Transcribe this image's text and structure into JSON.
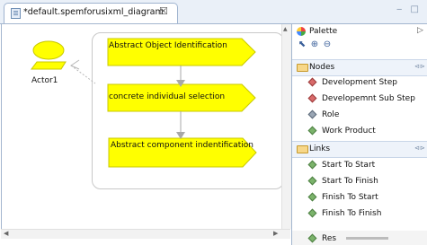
{
  "editor_tab": {
    "title": "*default.spemforusixml_diagram",
    "close_glyph": "☒"
  },
  "window_controls": "‒ □",
  "diagram": {
    "actor_label": "Actor1",
    "tasks": [
      {
        "label": "Abstract Object Identification"
      },
      {
        "label": "concrete individual selection"
      },
      {
        "label": "Abstract component indentification"
      }
    ],
    "colors": {
      "task_fill": "#ffff00",
      "task_stroke": "#c8c800",
      "arrow": "#a8a8a8"
    }
  },
  "palette": {
    "title": "Palette",
    "collapse_glyph": "▷",
    "drawers": [
      {
        "label": "Nodes",
        "items": [
          {
            "label": "Development Step",
            "icon": "red"
          },
          {
            "label": "Developemnt Sub Step",
            "icon": "red"
          },
          {
            "label": "Role",
            "icon": "gray"
          },
          {
            "label": "Work Product",
            "icon": "green"
          }
        ]
      },
      {
        "label": "Links",
        "items": [
          {
            "label": "Start To Start",
            "icon": "green"
          },
          {
            "label": "Start To Finish",
            "icon": "green"
          },
          {
            "label": "Finish To Start",
            "icon": "green"
          },
          {
            "label": "Finish To Finish",
            "icon": "green"
          }
        ]
      }
    ],
    "partial_item": "Res"
  }
}
